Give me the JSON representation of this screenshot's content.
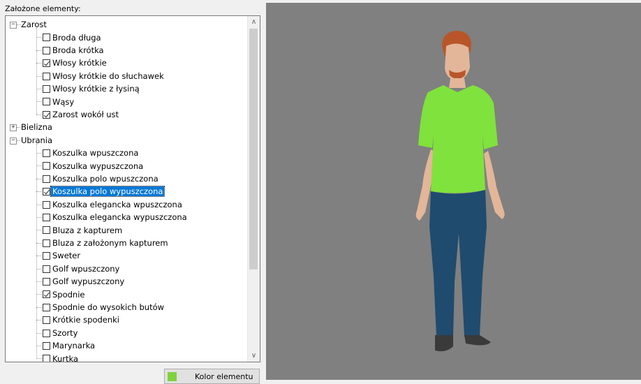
{
  "panel": {
    "label": "Założone elementy:"
  },
  "tree": {
    "categories": [
      {
        "label": "Zarost",
        "expanded": true,
        "items": [
          {
            "label": "Broda długa",
            "checked": false
          },
          {
            "label": "Broda krótka",
            "checked": false
          },
          {
            "label": "Włosy krótkie",
            "checked": true
          },
          {
            "label": "Włosy krótkie do słuchawek",
            "checked": false
          },
          {
            "label": "Włosy krótkie z łysiną",
            "checked": false
          },
          {
            "label": "Wąsy",
            "checked": false
          },
          {
            "label": "Zarost wokół ust",
            "checked": true
          }
        ]
      },
      {
        "label": "Bielizna",
        "expanded": false,
        "items": []
      },
      {
        "label": "Ubrania",
        "expanded": true,
        "items": [
          {
            "label": "Koszulka wpuszczona",
            "checked": false
          },
          {
            "label": "Koszulka wypuszczona",
            "checked": false
          },
          {
            "label": "Koszulka polo wpuszczona",
            "checked": false
          },
          {
            "label": "Koszulka polo wypuszczona",
            "checked": true,
            "selected": true
          },
          {
            "label": "Koszulka elegancka wpuszczona",
            "checked": false
          },
          {
            "label": "Koszulka elegancka wypuszczona",
            "checked": false
          },
          {
            "label": "Bluza z kapturem",
            "checked": false
          },
          {
            "label": "Bluza z założonym kapturem",
            "checked": false
          },
          {
            "label": "Sweter",
            "checked": false
          },
          {
            "label": "Golf wpuszczony",
            "checked": false
          },
          {
            "label": "Golf wypuszczony",
            "checked": false
          },
          {
            "label": "Spodnie",
            "checked": true
          },
          {
            "label": "Spodnie do wysokich butów",
            "checked": false
          },
          {
            "label": "Krótkie spodenki",
            "checked": false
          },
          {
            "label": "Szorty",
            "checked": false
          },
          {
            "label": "Marynarka",
            "checked": false
          },
          {
            "label": "Kurtka",
            "checked": false
          }
        ]
      }
    ]
  },
  "icons": {
    "expand": "plus-box-icon",
    "collapse": "minus-box-icon",
    "scroll_up": "chevron-up-icon",
    "scroll_down": "chevron-down-icon"
  },
  "color_button": {
    "label": "Kolor elementu",
    "swatch_color": "#80d23c"
  },
  "viewport": {
    "background": "#808080",
    "colors": {
      "skin": "#e3b699",
      "hair": "#b8562a",
      "shirt": "#80e23c",
      "pants": "#1f4b6e",
      "shoes": "#3a3a3a"
    }
  }
}
